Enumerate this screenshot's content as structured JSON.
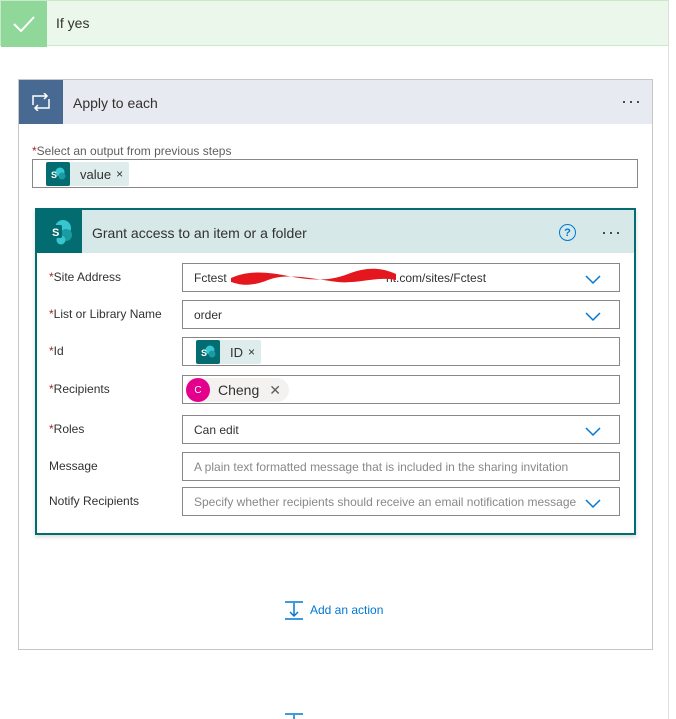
{
  "condition": {
    "branch_label": "If yes",
    "icon": "checkmark-icon",
    "accent_color": "#8fd89a"
  },
  "apply_to_each": {
    "title": "Apply to each",
    "icon": "loop-icon",
    "more_label": "···",
    "select_output_label": "Select an output from previous steps",
    "required_mark": "*",
    "token": {
      "text": "value",
      "icon": "sharepoint-icon",
      "remove": "×"
    }
  },
  "action": {
    "title": "Grant access to an item or a folder",
    "icon": "sharepoint-icon",
    "help_label": "?",
    "more_label": "···",
    "fields": {
      "site_address": {
        "label": "Site Address",
        "required": true,
        "value_prefix": "Fctest",
        "value_suffix": "nt.com/sites/Fctest"
      },
      "list_name": {
        "label": "List or Library Name",
        "required": true,
        "value": "order"
      },
      "id": {
        "label": "Id",
        "required": true,
        "token_text": "ID",
        "token_remove": "×"
      },
      "recipients": {
        "label": "Recipients",
        "required": true,
        "person_initial": "C",
        "person_name": "Cheng",
        "person_remove": "✕"
      },
      "roles": {
        "label": "Roles",
        "required": true,
        "value": "Can edit"
      },
      "message": {
        "label": "Message",
        "required": false,
        "placeholder": "A plain text formatted message that is included in the sharing invitation"
      },
      "notify": {
        "label": "Notify Recipients",
        "required": false,
        "placeholder": "Specify whether recipients should receive an email notification message"
      }
    }
  },
  "add_action": {
    "label": "Add an action",
    "icon": "insert-step-icon"
  },
  "colors": {
    "sharepoint": "#036c70",
    "loop": "#486991",
    "link": "#0078d4",
    "avatar": "#e3008c"
  }
}
